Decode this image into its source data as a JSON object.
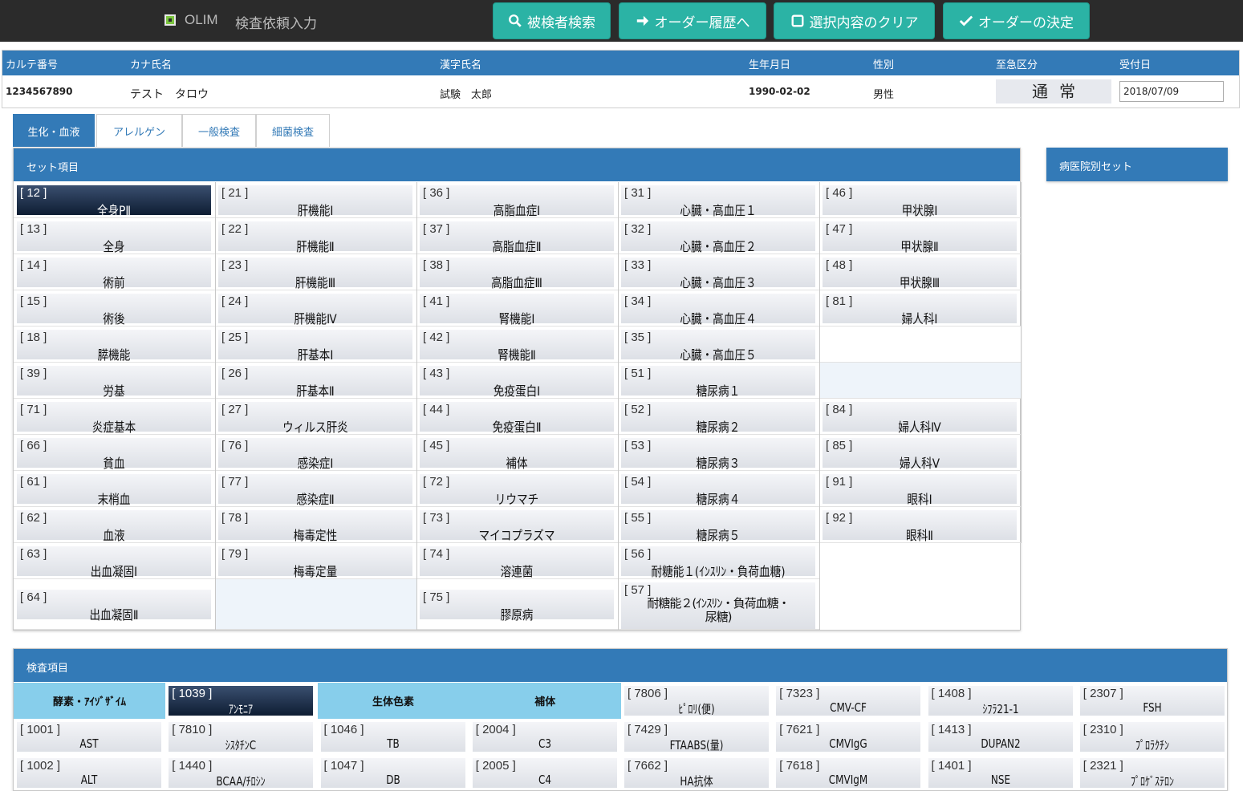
{
  "app": {
    "name": "OLIM",
    "title": "検査依頼入力"
  },
  "toolbar": [
    {
      "id": "search",
      "label": "被検者検索",
      "icon": "search-icon"
    },
    {
      "id": "history",
      "label": "オーダー履歴へ",
      "icon": "arrow-right-icon"
    },
    {
      "id": "clear",
      "label": "選択内容のクリア",
      "icon": "square-icon"
    },
    {
      "id": "decide",
      "label": "オーダーの決定",
      "icon": "check-icon"
    }
  ],
  "patient": {
    "headers": {
      "chart_no": "カルテ番号",
      "kana": "カナ氏名",
      "kanji": "漢字氏名",
      "birth": "生年月日",
      "sex": "性別",
      "urgency": "至急区分",
      "received": "受付日"
    },
    "values": {
      "chart_no": "1234567890",
      "kana": "テスト　タロウ",
      "kanji": "試験　太郎",
      "birth": "1990-02-02",
      "sex": "男性",
      "urgency": "通常",
      "received": "2018/07/09"
    }
  },
  "tabs": [
    {
      "label": "生化・血液",
      "active": true
    },
    {
      "label": "アレルゲン",
      "active": false
    },
    {
      "label": "一般検査",
      "active": false
    },
    {
      "label": "細菌検査",
      "active": false
    }
  ],
  "set_panel": {
    "title": "セット項目",
    "columns": [
      [
        {
          "code": "[ 12 ]",
          "label": "全身PⅡ",
          "selected": true
        },
        {
          "code": "[ 13 ]",
          "label": "全身"
        },
        {
          "code": "[ 14 ]",
          "label": "術前"
        },
        {
          "code": "[ 15 ]",
          "label": "術後"
        },
        {
          "code": "[ 18 ]",
          "label": "膵機能"
        },
        {
          "code": "[ 39 ]",
          "label": "労基"
        },
        {
          "code": "[ 71 ]",
          "label": "炎症基本"
        },
        {
          "code": "[ 66 ]",
          "label": "貧血"
        },
        {
          "code": "[ 61 ]",
          "label": "末梢血"
        },
        {
          "code": "[ 62 ]",
          "label": "血液"
        },
        {
          "code": "[ 63 ]",
          "label": "出血凝固Ⅰ"
        },
        {
          "code": "[ 64 ]",
          "label": "出血凝固Ⅱ"
        }
      ],
      [
        {
          "code": "[ 21 ]",
          "label": "肝機能Ⅰ"
        },
        {
          "code": "[ 22 ]",
          "label": "肝機能Ⅱ"
        },
        {
          "code": "[ 23 ]",
          "label": "肝機能Ⅲ"
        },
        {
          "code": "[ 24 ]",
          "label": "肝機能Ⅳ"
        },
        {
          "code": "[ 25 ]",
          "label": "肝基本Ⅰ"
        },
        {
          "code": "[ 26 ]",
          "label": "肝基本Ⅱ"
        },
        {
          "code": "[ 27 ]",
          "label": "ウィルス肝炎"
        },
        {
          "code": "[ 76 ]",
          "label": "感染症Ⅰ"
        },
        {
          "code": "[ 77 ]",
          "label": "感染症Ⅱ"
        },
        {
          "code": "[ 78 ]",
          "label": "梅毒定性"
        },
        {
          "code": "[ 79 ]",
          "label": "梅毒定量"
        },
        null
      ],
      [
        {
          "code": "[ 36 ]",
          "label": "高脂血症Ⅰ"
        },
        {
          "code": "[ 37 ]",
          "label": "高脂血症Ⅱ"
        },
        {
          "code": "[ 38 ]",
          "label": "高脂血症Ⅲ"
        },
        {
          "code": "[ 41 ]",
          "label": "腎機能Ⅰ"
        },
        {
          "code": "[ 42 ]",
          "label": "腎機能Ⅱ"
        },
        {
          "code": "[ 43 ]",
          "label": "免疫蛋白Ⅰ"
        },
        {
          "code": "[ 44 ]",
          "label": "免疫蛋白Ⅱ"
        },
        {
          "code": "[ 45 ]",
          "label": "補体"
        },
        {
          "code": "[ 72 ]",
          "label": "リウマチ"
        },
        {
          "code": "[ 73 ]",
          "label": "マイコプラズマ"
        },
        {
          "code": "[ 74 ]",
          "label": "溶連菌"
        },
        {
          "code": "[ 75 ]",
          "label": "膠原病"
        }
      ],
      [
        {
          "code": "[ 31 ]",
          "label": "心臓・高血圧１"
        },
        {
          "code": "[ 32 ]",
          "label": "心臓・高血圧２"
        },
        {
          "code": "[ 33 ]",
          "label": "心臓・高血圧３"
        },
        {
          "code": "[ 34 ]",
          "label": "心臓・高血圧４"
        },
        {
          "code": "[ 35 ]",
          "label": "心臓・高血圧５"
        },
        {
          "code": "[ 51 ]",
          "label": "糖尿病１"
        },
        {
          "code": "[ 52 ]",
          "label": "糖尿病２"
        },
        {
          "code": "[ 53 ]",
          "label": "糖尿病３"
        },
        {
          "code": "[ 54 ]",
          "label": "糖尿病４"
        },
        {
          "code": "[ 55 ]",
          "label": "糖尿病５"
        },
        {
          "code": "[ 56 ]",
          "label": "耐糖能１(ｲﾝｽﾘﾝ・負荷血糖)"
        },
        {
          "code": "[ 57 ]",
          "label": "耐糖能２(ｲﾝｽﾘﾝ・負荷血糖・尿糖)"
        }
      ],
      [
        {
          "code": "[ 46 ]",
          "label": "甲状腺Ⅰ"
        },
        {
          "code": "[ 47 ]",
          "label": "甲状腺Ⅱ"
        },
        {
          "code": "[ 48 ]",
          "label": "甲状腺Ⅲ"
        },
        {
          "code": "[ 81 ]",
          "label": "婦人科Ⅰ"
        },
        null,
        null,
        {
          "code": "[ 84 ]",
          "label": "婦人科Ⅳ"
        },
        {
          "code": "[ 85 ]",
          "label": "婦人科Ⅴ"
        },
        {
          "code": "[ 91 ]",
          "label": "眼科Ⅰ"
        },
        {
          "code": "[ 92 ]",
          "label": "眼科Ⅱ"
        },
        null,
        null
      ]
    ]
  },
  "hospital_set": {
    "title": "病医院別セット"
  },
  "kensa_panel": {
    "title": "検査項目",
    "columns": [
      {
        "category": "酵素・ｱｲｿﾞｻﾞｲﾑ",
        "items": [
          {
            "code": "[ 1001 ]",
            "label": "AST"
          },
          {
            "code": "[ 1002 ]",
            "label": "ALT"
          }
        ]
      },
      {
        "category": null,
        "items": [
          {
            "code": "[ 1039 ]",
            "label": "ｱﾝﾓﾆｱ",
            "selected": true
          },
          {
            "code": "[ 7810 ]",
            "label": "ｼｽﾀﾁﾝC"
          },
          {
            "code": "[ 1440 ]",
            "label": "BCAA/ﾁﾛｼﾝ"
          }
        ]
      },
      {
        "category": "生体色素",
        "items": [
          {
            "code": "[ 1046 ]",
            "label": "TB"
          },
          {
            "code": "[ 1047 ]",
            "label": "DB"
          }
        ]
      },
      {
        "category": "補体",
        "items": [
          {
            "code": "[ 2004 ]",
            "label": "C3"
          },
          {
            "code": "[ 2005 ]",
            "label": "C4"
          }
        ]
      },
      {
        "category": null,
        "items": [
          {
            "code": "[ 7806 ]",
            "label": "ﾋﾟﾛﾘ(便)"
          },
          {
            "code": "[ 7429 ]",
            "label": "FTAABS(量)"
          },
          {
            "code": "[ 7662 ]",
            "label": "HA抗体"
          }
        ]
      },
      {
        "category": null,
        "items": [
          {
            "code": "[ 7323 ]",
            "label": "CMV-CF"
          },
          {
            "code": "[ 7621 ]",
            "label": "CMVIgG"
          },
          {
            "code": "[ 7618 ]",
            "label": "CMVIgM"
          }
        ]
      },
      {
        "category": null,
        "items": [
          {
            "code": "[ 1408 ]",
            "label": "ｼﾌﾗ21-1"
          },
          {
            "code": "[ 1413 ]",
            "label": "DUPAN2"
          },
          {
            "code": "[ 1401 ]",
            "label": "NSE"
          }
        ]
      },
      {
        "category": null,
        "items": [
          {
            "code": "[ 2307 ]",
            "label": "FSH"
          },
          {
            "code": "[ 2310 ]",
            "label": "ﾌﾟﾛﾗｸﾁﾝ"
          },
          {
            "code": "[ 2321 ]",
            "label": "ﾌﾟﾛｹﾞｽﾃﾛﾝ"
          }
        ]
      }
    ]
  },
  "colors": {
    "primary": "#337ab7",
    "teal": "#2bb3a5",
    "category": "#87ceeb",
    "selected": "#0e1d33"
  }
}
